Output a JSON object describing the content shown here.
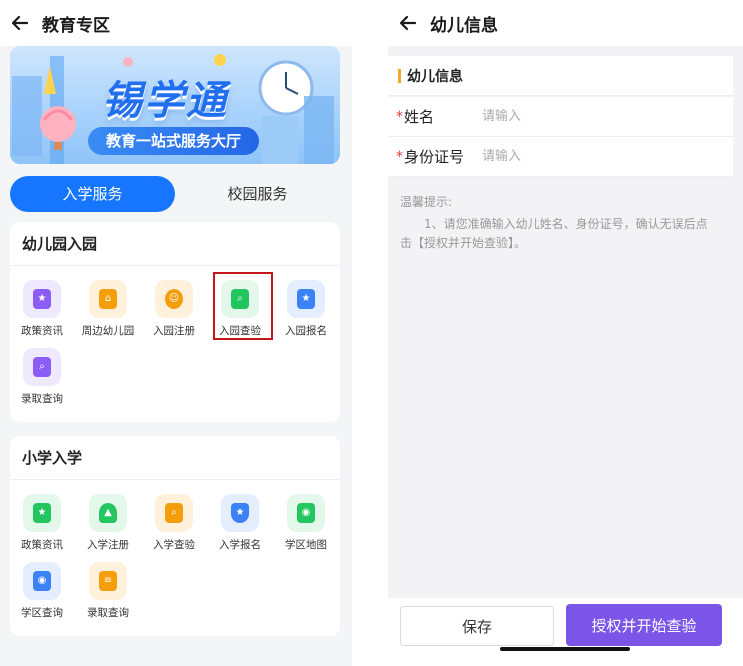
{
  "left": {
    "title": "教育专区",
    "banner": {
      "title": "锡学通",
      "subtitle": "教育一站式服务大厅"
    },
    "tabs": [
      {
        "label": "入学服务",
        "active": true
      },
      {
        "label": "校园服务",
        "active": false
      }
    ],
    "kindergarten": {
      "title": "幼儿园入园",
      "items": [
        {
          "label": "政策资讯",
          "icon": "policy-doc-icon",
          "color": "#8b5cf6",
          "bg": "#efe9fe"
        },
        {
          "label": "周边幼儿园",
          "icon": "kindergarten-building-icon",
          "color": "#f59e0b",
          "bg": "#fff1dc"
        },
        {
          "label": "入园注册",
          "icon": "smiley-face-icon",
          "color": "#f59e0b",
          "bg": "#fff1dc"
        },
        {
          "label": "入园查验",
          "icon": "document-search-icon",
          "color": "#22c55e",
          "bg": "#e3f7ea"
        },
        {
          "label": "入园报名",
          "icon": "bookmark-star-icon",
          "color": "#3b82f6",
          "bg": "#e4eeff"
        },
        {
          "label": "录取查询",
          "icon": "search-doc-icon",
          "color": "#8b5cf6",
          "bg": "#efe9fe"
        }
      ]
    },
    "primary": {
      "title": "小学入学",
      "items": [
        {
          "label": "政策资讯",
          "icon": "policy-doc-icon",
          "color": "#22c55e",
          "bg": "#e3f7ea"
        },
        {
          "label": "入学注册",
          "icon": "graduate-student-icon",
          "color": "#22c55e",
          "bg": "#e3f7ea"
        },
        {
          "label": "入学查验",
          "icon": "document-search-icon",
          "color": "#f59e0b",
          "bg": "#fff1dc"
        },
        {
          "label": "入学报名",
          "icon": "shield-star-icon",
          "color": "#3b82f6",
          "bg": "#e4eeff"
        },
        {
          "label": "学区地图",
          "icon": "map-pin-icon",
          "color": "#22c55e",
          "bg": "#e3f7ea"
        },
        {
          "label": "学区查询",
          "icon": "map-search-icon",
          "color": "#3b82f6",
          "bg": "#e4eeff"
        },
        {
          "label": "录取查询",
          "icon": "list-doc-icon",
          "color": "#f59e0b",
          "bg": "#fff1dc"
        }
      ]
    }
  },
  "right": {
    "title": "幼儿信息",
    "section_title": "幼儿信息",
    "fields": [
      {
        "label": "姓名",
        "placeholder": "请输入",
        "value": ""
      },
      {
        "label": "身份证号",
        "placeholder": "请输入",
        "value": ""
      }
    ],
    "tips_title": "温馨提示:",
    "tips_body": "1、请您准确输入幼儿姓名、身份证号，确认无误后点击【授权并开始查验】。",
    "save_label": "保存",
    "auth_label": "授权并开始查验"
  },
  "colors": {
    "primary_blue": "#1676ff",
    "purple": "#7b54e8",
    "required_star": "#e53935",
    "highlight_red": "#c4161c"
  }
}
